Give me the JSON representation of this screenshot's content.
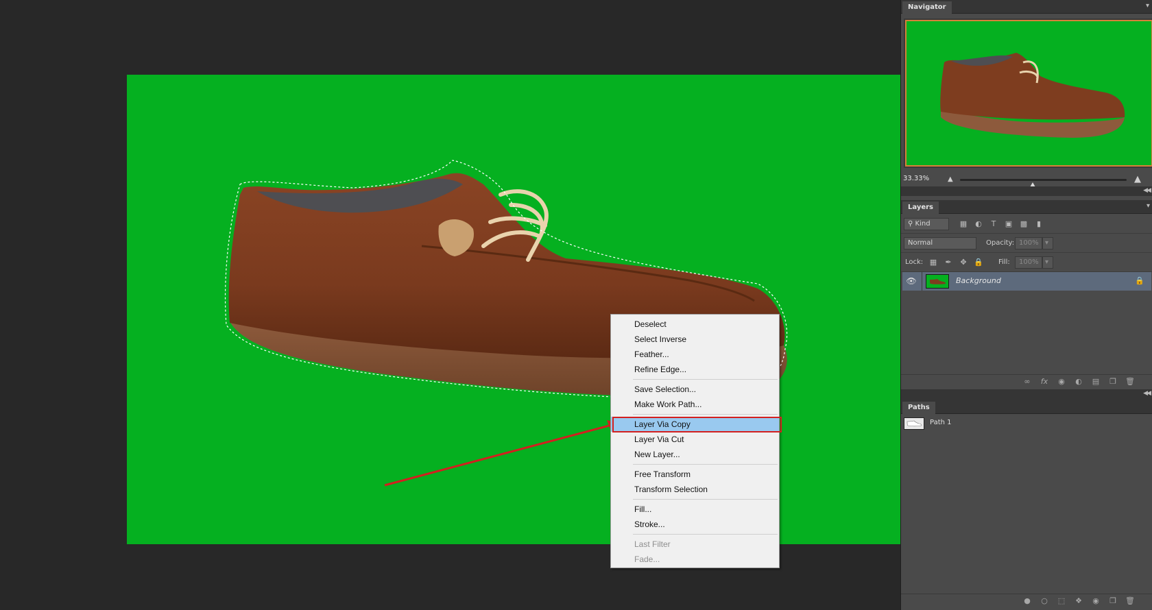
{
  "navigator": {
    "tab_label": "Navigator",
    "zoom": "33.33%",
    "zoom_slider_fraction": 0.42
  },
  "layers": {
    "tab_label": "Layers",
    "filter_kind": "Kind",
    "blend_mode": "Normal",
    "opacity_label": "Opacity:",
    "opacity_value": "100%",
    "lock_label": "Lock:",
    "fill_label": "Fill:",
    "fill_value": "100%",
    "items": [
      {
        "name": "Background",
        "visible": true,
        "locked": true
      }
    ]
  },
  "paths": {
    "tab_label": "Paths",
    "items": [
      {
        "name": "Path 1"
      }
    ]
  },
  "context_menu": {
    "groups": [
      [
        {
          "label": "Deselect"
        },
        {
          "label": "Select Inverse"
        },
        {
          "label": "Feather..."
        },
        {
          "label": "Refine Edge..."
        }
      ],
      [
        {
          "label": "Save Selection..."
        },
        {
          "label": "Make Work Path..."
        }
      ],
      [
        {
          "label": "Layer Via Copy",
          "highlighted": true
        },
        {
          "label": "Layer Via Cut"
        },
        {
          "label": "New Layer..."
        }
      ],
      [
        {
          "label": "Free Transform"
        },
        {
          "label": "Transform Selection"
        }
      ],
      [
        {
          "label": "Fill..."
        },
        {
          "label": "Stroke..."
        }
      ],
      [
        {
          "label": "Last Filter",
          "disabled": true
        },
        {
          "label": "Fade...",
          "disabled": true
        }
      ]
    ]
  },
  "colors": {
    "canvas_background": "#05b020",
    "menu_highlight": "#99c9ef",
    "annotation_red": "#d31f1f",
    "navigator_frame": "#d8803a",
    "selected_layer": "#5d6a7c"
  },
  "icons": {
    "visibility": "eye-icon",
    "layer_lock": "lock-icon",
    "path_thumbnail": "shoe-path-icon"
  }
}
